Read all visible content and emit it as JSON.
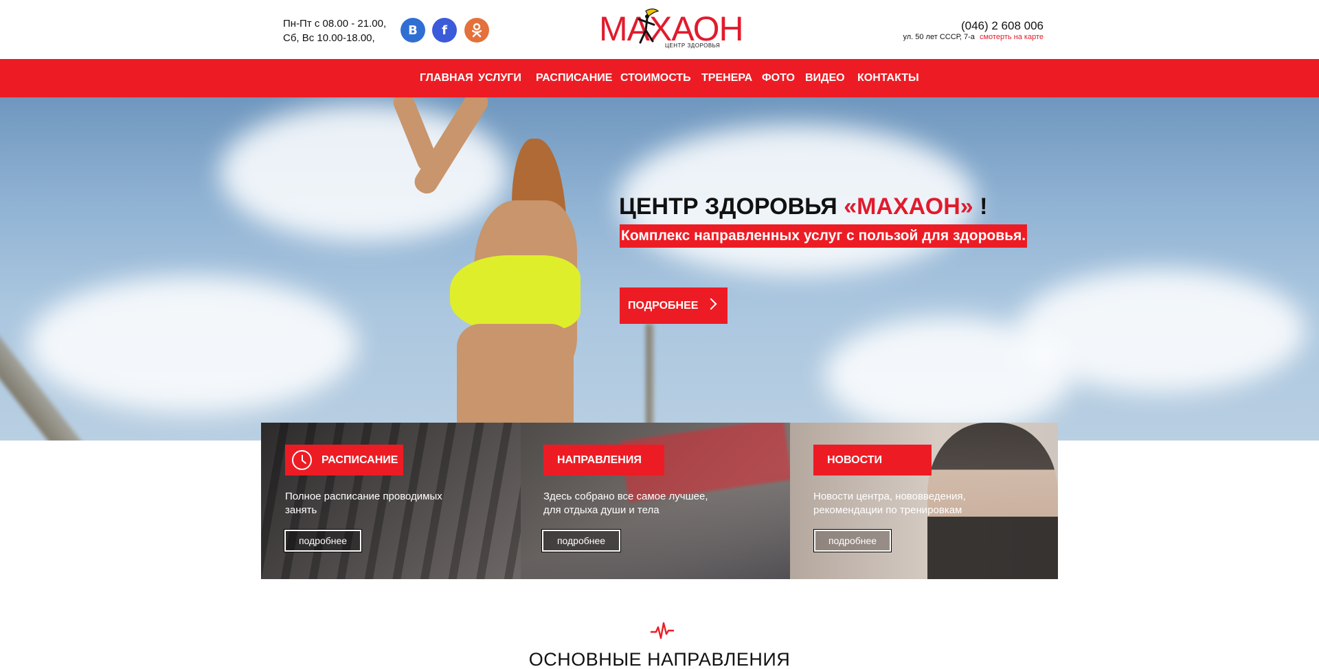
{
  "header": {
    "hours_line1": "Пн-Пт с 08.00 - 21.00,",
    "hours_line2": "Сб, Вс 10.00-18.00,",
    "social": [
      {
        "name": "vk-icon",
        "glyph": "B"
      },
      {
        "name": "facebook-icon",
        "glyph": "f"
      },
      {
        "name": "odnoklassniki-icon",
        "glyph": "ok"
      }
    ],
    "logo_text": "МАХАОН",
    "logo_subtitle": "ЦЕНТР ЗДОРОВЬЯ",
    "phone": "(046) 2 608 006",
    "address": "ул. 50 лет СССР, 7-а",
    "map_link": "смотерть на карте"
  },
  "nav": {
    "items": [
      {
        "label": "ГЛАВНАЯ"
      },
      {
        "label": "УСЛУГИ"
      },
      {
        "label": "РАСПИСАНИЕ"
      },
      {
        "label": "СТОИМОСТЬ"
      },
      {
        "label": "ТРЕНЕРА"
      },
      {
        "label": "ФОТО"
      },
      {
        "label": "ВИДЕО"
      },
      {
        "label": "КОНТАКТЫ"
      }
    ]
  },
  "hero": {
    "title_prefix": "ЦЕНТР ЗДОРОВЬЯ",
    "title_brand": "«МАХАОН»",
    "title_suffix": "!",
    "subtitle": "Комплекс направленных услуг с пользой для здоровья.",
    "button_label": "ПОДРОБНЕЕ"
  },
  "cards": [
    {
      "label": "РАСПИСАНИЕ",
      "text": "Полное расписание проводимых занять",
      "button": "подробнее"
    },
    {
      "label": "НАПРАВЛЕНИЯ",
      "text": "Здесь собрано все самое лучшее, для отдыха души и тела",
      "button": "подробнее"
    },
    {
      "label": "НОВОСТИ",
      "text": "Новости центра, нововведения, рекомендации по тренировкам",
      "button": "подробнее"
    }
  ],
  "section": {
    "title": "ОСНОВНЫЕ НАПРАВЛЕНИЯ"
  },
  "colors": {
    "accent": "#ed1c24",
    "brand": "#e11b2d"
  }
}
